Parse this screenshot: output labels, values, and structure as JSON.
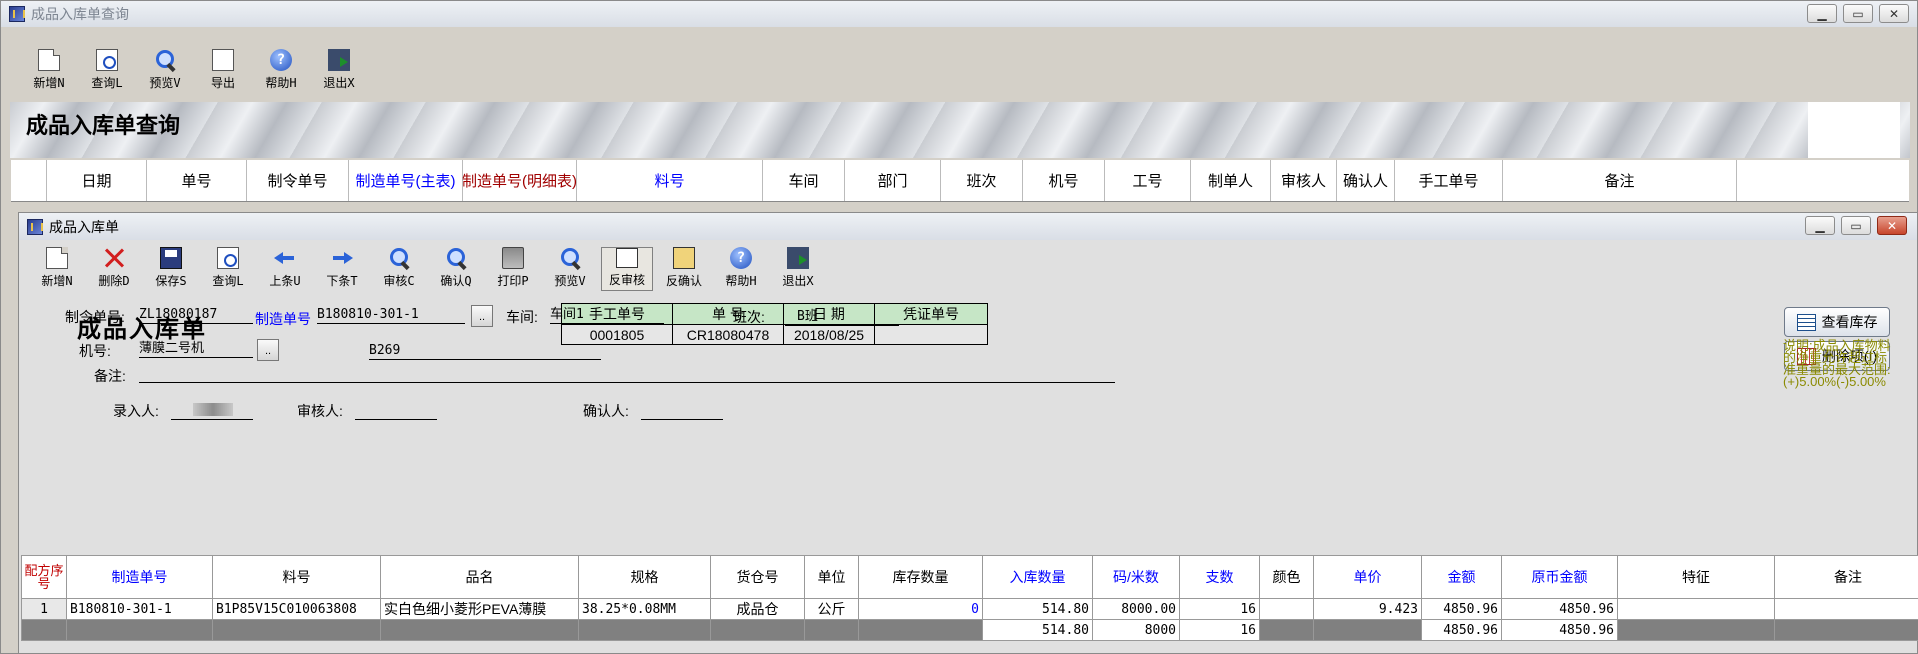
{
  "outer": {
    "title": "成品入库单查询",
    "toolbar": [
      {
        "label": "新增N",
        "icon": "new-icon"
      },
      {
        "label": "查询L",
        "icon": "query-icon"
      },
      {
        "label": "预览V",
        "icon": "preview-icon"
      },
      {
        "label": "导出",
        "icon": "export-icon"
      },
      {
        "label": "帮助H",
        "icon": "help-icon"
      },
      {
        "label": "退出X",
        "icon": "exit-icon"
      }
    ],
    "banner_title": "成品入库单查询",
    "columns": [
      {
        "label": "日期",
        "color": "#000000"
      },
      {
        "label": "单号",
        "color": "#000000"
      },
      {
        "label": "制令单号",
        "color": "#000000"
      },
      {
        "label": "制造单号(主表)",
        "color": "#0000ff"
      },
      {
        "label": "制造单号(明细表)",
        "color": "#a00000"
      },
      {
        "label": "料号",
        "color": "#0000ff"
      },
      {
        "label": "车间",
        "color": "#000000"
      },
      {
        "label": "部门",
        "color": "#000000"
      },
      {
        "label": "班次",
        "color": "#000000"
      },
      {
        "label": "机号",
        "color": "#000000"
      },
      {
        "label": "工号",
        "color": "#000000"
      },
      {
        "label": "制单人",
        "color": "#000000"
      },
      {
        "label": "审核人",
        "color": "#000000"
      },
      {
        "label": "确认人",
        "color": "#000000"
      },
      {
        "label": "手工单号",
        "color": "#000000"
      },
      {
        "label": "备注",
        "color": "#000000"
      }
    ]
  },
  "inner": {
    "title": "成品入库单",
    "toolbar": [
      {
        "label": "新增N",
        "icon": "new-icon"
      },
      {
        "label": "删除D",
        "icon": "delete-icon"
      },
      {
        "label": "保存S",
        "icon": "save-icon"
      },
      {
        "label": "查询L",
        "icon": "query-icon"
      },
      {
        "label": "上条U",
        "icon": "prev-icon"
      },
      {
        "label": "下条T",
        "icon": "next-icon"
      },
      {
        "label": "审核C",
        "icon": "audit-icon"
      },
      {
        "label": "确认Q",
        "icon": "confirm-icon"
      },
      {
        "label": "打印P",
        "icon": "print-icon"
      },
      {
        "label": "预览V",
        "icon": "preview-icon"
      },
      {
        "label": "反审核",
        "icon": "unaudit-icon"
      },
      {
        "label": "反确认",
        "icon": "unconfirm-icon"
      },
      {
        "label": "帮助H",
        "icon": "help-icon"
      },
      {
        "label": "退出X",
        "icon": "exit-icon"
      }
    ],
    "doc_title": "成品入库单",
    "info": {
      "h_manual": "手工单号",
      "h_no": "单  号",
      "h_date": "日  期",
      "h_voucher": "凭证单号",
      "manual": "0001805",
      "no": "CR18080478",
      "date": "2018/08/25",
      "voucher": ""
    },
    "form": {
      "order_label": "制令单号:",
      "order_value": "ZL18080187",
      "mfg_label": "制造单号",
      "mfg_value": "B180810-301-1",
      "workshop_label": "车间:",
      "workshop_value": "车间1",
      "shift_label": "班次:",
      "shift_value": "B班",
      "machine_label": "机号:",
      "machine_value": "薄膜二号机",
      "code_value": "B269",
      "remark_label": "备注:",
      "remark_value": "",
      "entry_label": "录入人:",
      "audit_label": "审核人:",
      "confirm_label": "确认人:"
    },
    "side": {
      "stock_btn": "查看库存",
      "delete_btn": "删除项(I)",
      "note": "说明:成品入库物料的净重允许超过标准重量的最大范围:(+)5.00%(-)5.00%"
    },
    "grid": {
      "headers": [
        {
          "label": "配方序号",
          "color": "#c00000"
        },
        {
          "label": "制造单号",
          "color": "#0000ff"
        },
        {
          "label": "料号",
          "color": "#000000"
        },
        {
          "label": "品名",
          "color": "#000000"
        },
        {
          "label": "规格",
          "color": "#000000"
        },
        {
          "label": "货仓号",
          "color": "#000000"
        },
        {
          "label": "单位",
          "color": "#000000"
        },
        {
          "label": "库存数量",
          "color": "#000000"
        },
        {
          "label": "入库数量",
          "color": "#0000ff"
        },
        {
          "label": "码/米数",
          "color": "#0000ff"
        },
        {
          "label": "支数",
          "color": "#0000ff"
        },
        {
          "label": "颜色",
          "color": "#000000"
        },
        {
          "label": "单价",
          "color": "#0000ff"
        },
        {
          "label": "金额",
          "color": "#0000ff"
        },
        {
          "label": "原币金额",
          "color": "#0000ff"
        },
        {
          "label": "特征",
          "color": "#000000"
        },
        {
          "label": "备注",
          "color": "#000000"
        }
      ],
      "rows": [
        [
          "1",
          "B180810-301-1",
          "B1P85V15C010063808",
          "实白色细小菱形PEVA薄膜",
          "38.25*0.08MM",
          "成品仓",
          "公斤",
          "0",
          "514.80",
          "8000.00",
          "16",
          "",
          "9.423",
          "4850.96",
          "4850.96",
          "",
          ""
        ]
      ],
      "totals": {
        "qty": "514.80",
        "yards": "8000",
        "count": "16",
        "amount": "4850.96",
        "orig_amount": "4850.96"
      }
    }
  }
}
